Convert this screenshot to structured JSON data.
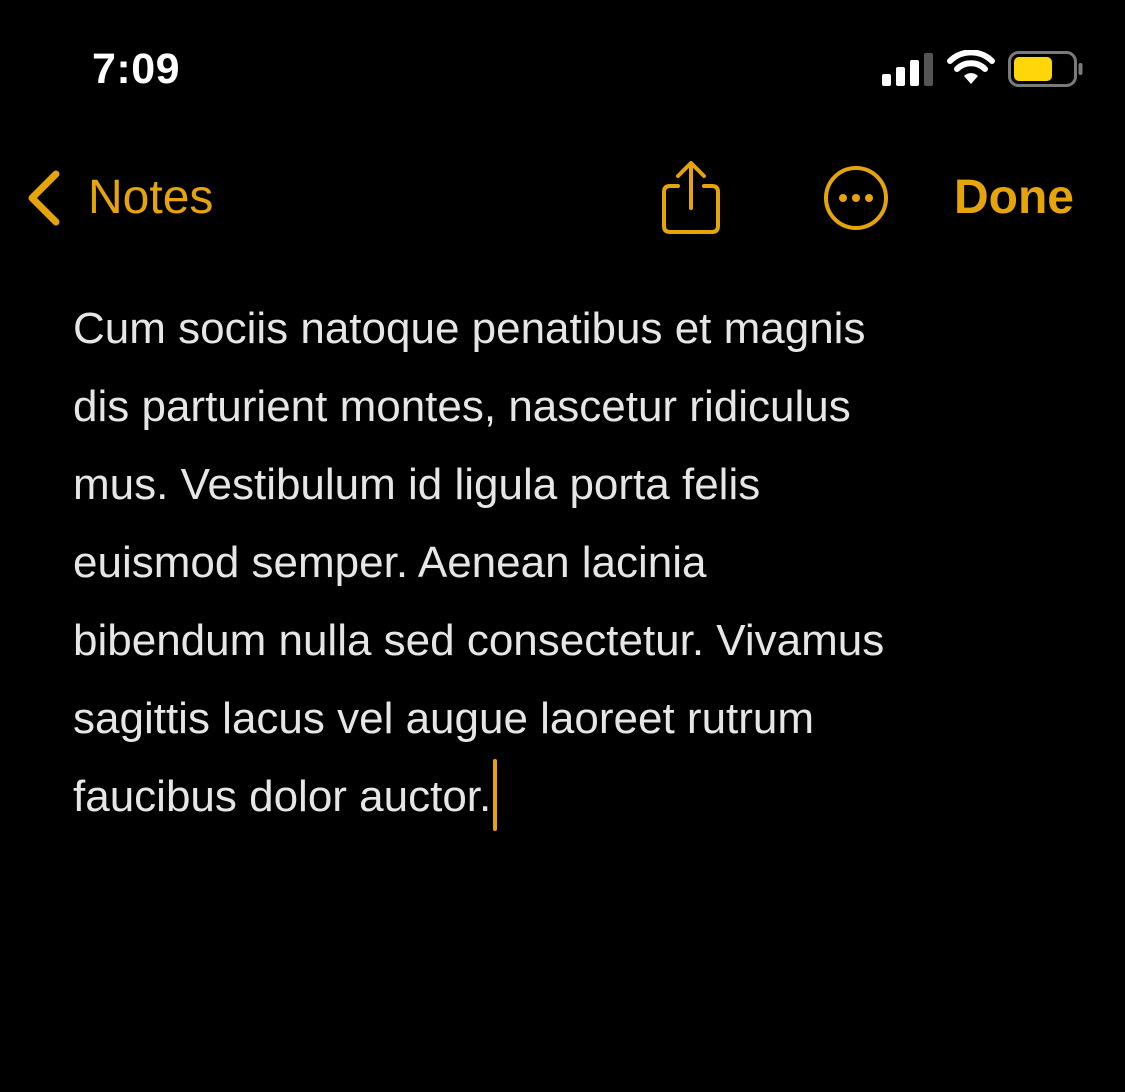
{
  "status_bar": {
    "time": "7:09",
    "icons": [
      "signal-icon",
      "wifi-icon",
      "battery-icon"
    ]
  },
  "nav": {
    "back_label": "Notes",
    "back_icon": "chevron-left-icon",
    "share_icon": "share-icon",
    "more_icon": "ellipsis-circle-icon",
    "done_label": "Done"
  },
  "note": {
    "lines": [
      "Cum sociis natoque penatibus et magnis",
      "dis parturient montes, nascetur ridiculus",
      "mus. Vestibulum id ligula porta felis",
      "euismod semper. Aenean lacinia",
      "bibendum nulla sed consectetur. Vivamus",
      "sagittis lacus vel augue laoreet rutrum",
      "faucibus dolor auctor."
    ]
  },
  "colors": {
    "accent": "#e5a50a",
    "background": "#000000",
    "text": "#e6e6e6",
    "battery_fill": "#ffd60a"
  }
}
